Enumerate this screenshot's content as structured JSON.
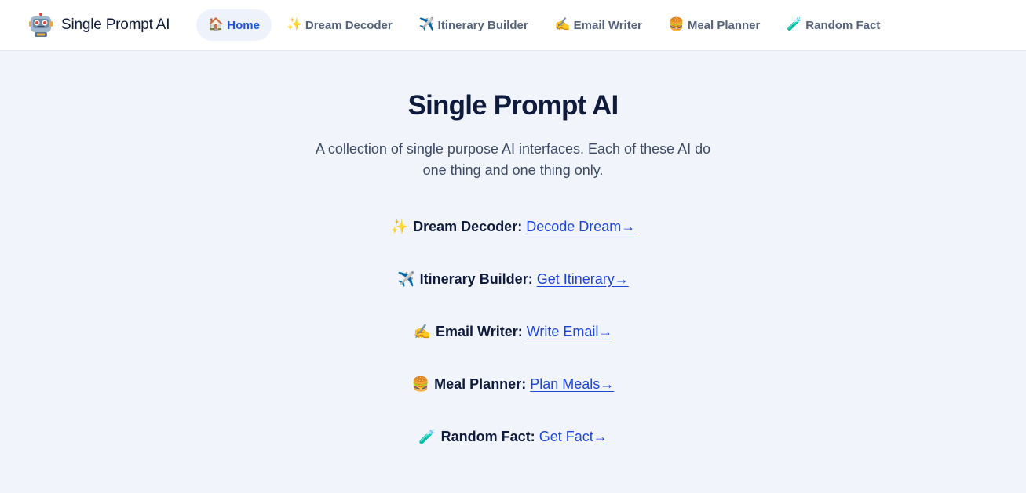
{
  "brand": {
    "name": "Single Prompt AI",
    "logo_icon": "robot-icon"
  },
  "nav": {
    "items": [
      {
        "emoji": "🏠",
        "label": "Home",
        "active": true
      },
      {
        "emoji": "✨",
        "label": "Dream Decoder",
        "active": false
      },
      {
        "emoji": "✈️",
        "label": "Itinerary Builder",
        "active": false
      },
      {
        "emoji": "✍️",
        "label": "Email Writer",
        "active": false
      },
      {
        "emoji": "🍔",
        "label": "Meal Planner",
        "active": false
      },
      {
        "emoji": "🧪",
        "label": "Random Fact",
        "active": false
      }
    ]
  },
  "main": {
    "title": "Single Prompt AI",
    "subtitle": "A collection of single purpose AI interfaces. Each of these AI do one thing and one thing only.",
    "tools": [
      {
        "emoji": "✨",
        "name": "Dream Decoder:",
        "link": "Decode Dream→"
      },
      {
        "emoji": "✈️",
        "name": "Itinerary Builder:",
        "link": "Get Itinerary→"
      },
      {
        "emoji": "✍️",
        "name": "Email Writer:",
        "link": "Write Email→"
      },
      {
        "emoji": "🍔",
        "name": "Meal Planner:",
        "link": "Plan Meals→"
      },
      {
        "emoji": "🧪",
        "name": "Random Fact:",
        "link": "Get Fact→"
      }
    ]
  },
  "colors": {
    "background": "#f1f4fb",
    "navbar": "#ffffff",
    "accent": "#1e56d8",
    "link": "#1d44d8",
    "heading": "#0f1b3d"
  }
}
